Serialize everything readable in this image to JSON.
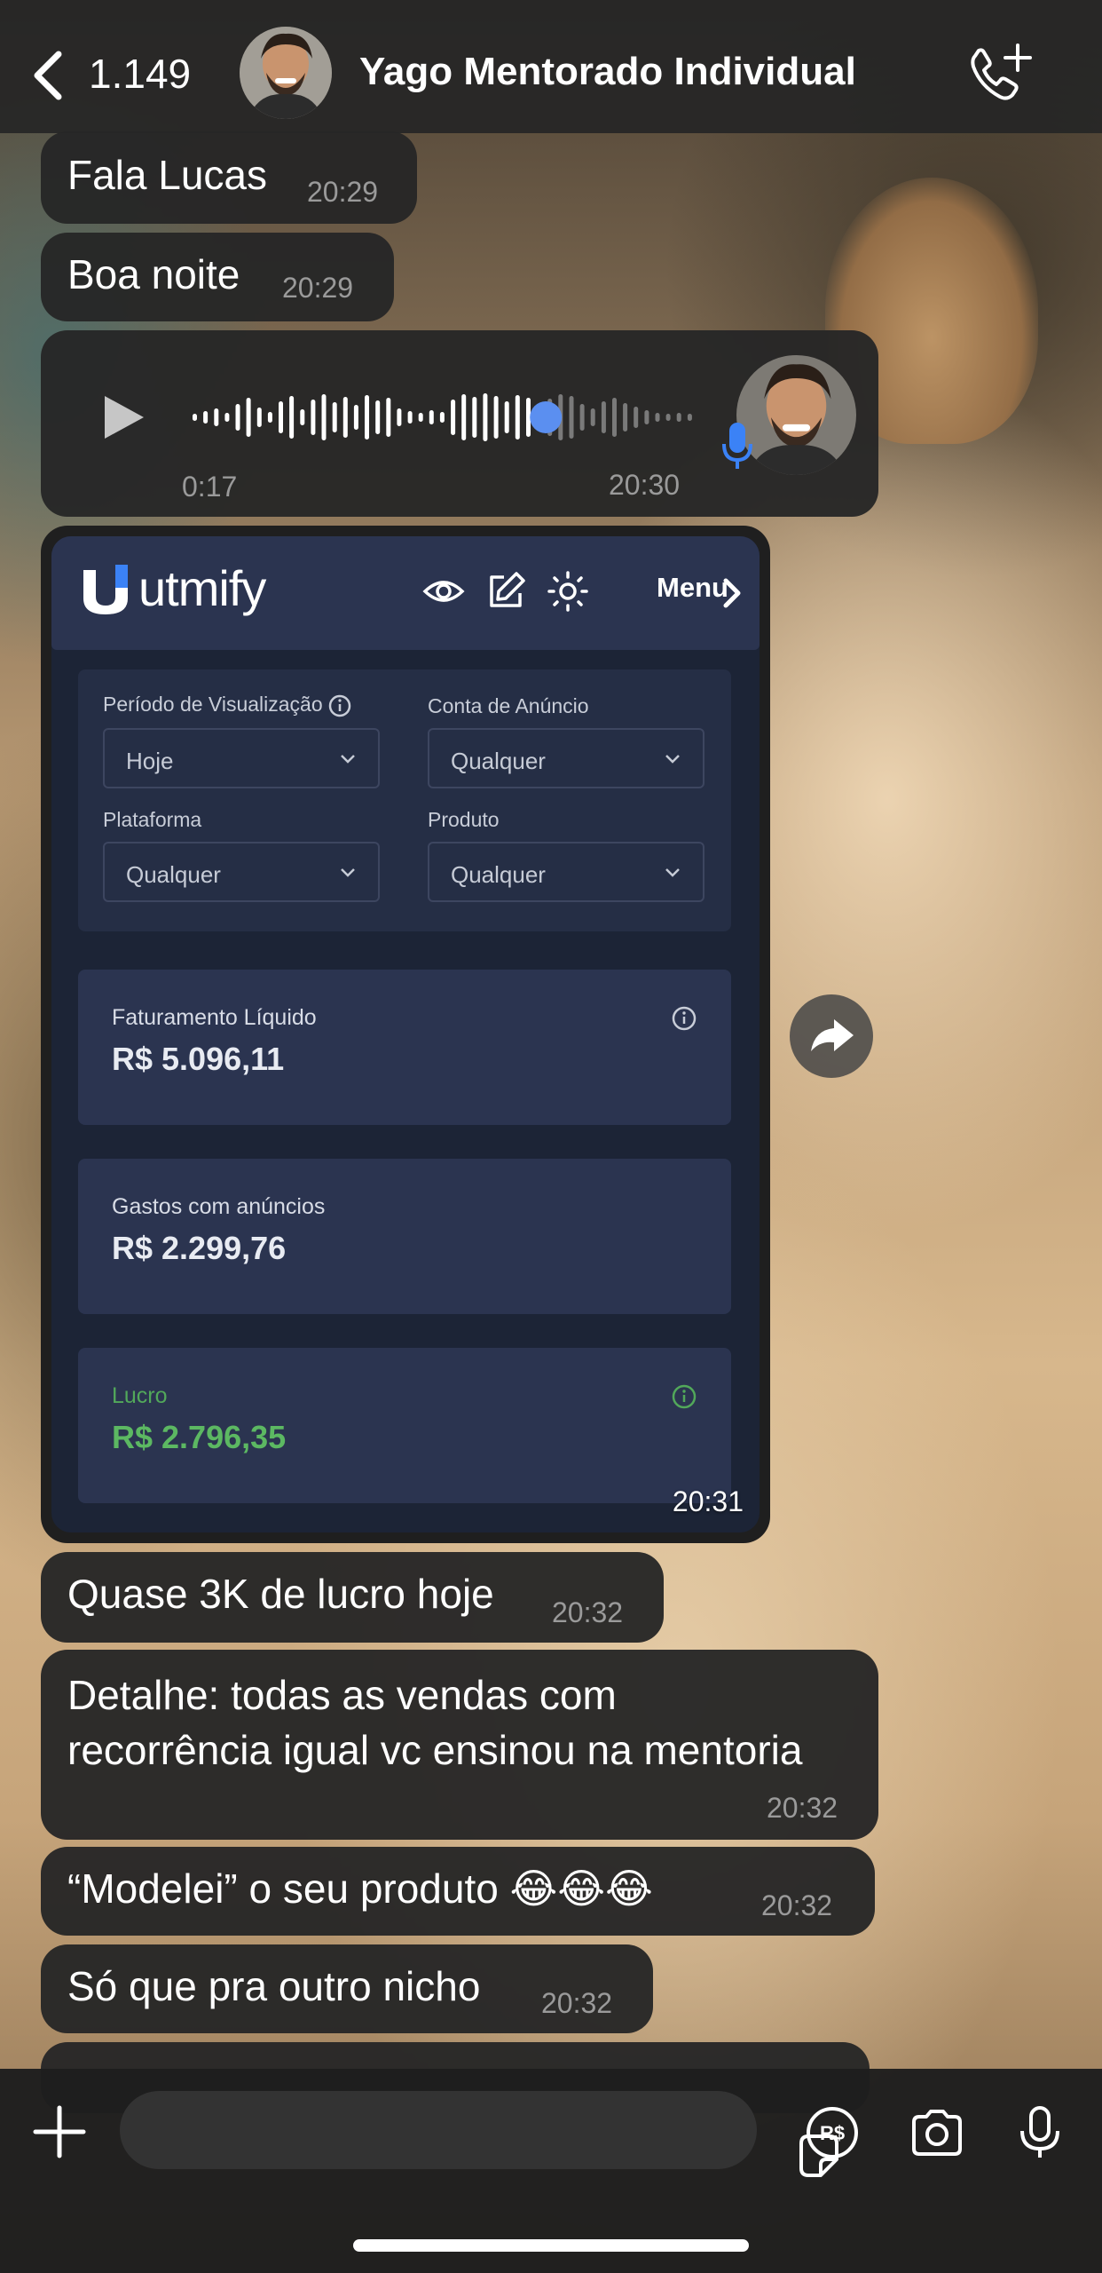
{
  "header": {
    "back_count": "1.149",
    "title": "Yago Mentorado Individual"
  },
  "messages": {
    "m1": {
      "text": "Fala Lucas",
      "time": "20:29"
    },
    "m2": {
      "text": "Boa noite",
      "time": "20:29"
    },
    "audio": {
      "duration": "0:17",
      "time": "20:30",
      "progress": 0.7
    },
    "m4_image_time": "20:31",
    "m5": {
      "text": "Quase 3K de lucro hoje",
      "time": "20:32"
    },
    "m6": {
      "line1": "Detalhe: todas as vendas com",
      "line2": "recorrência igual vc ensinou na mentoria",
      "time": "20:32"
    },
    "m7": {
      "text": "“Modelei” o seu produto 😂😂😂",
      "time": "20:32"
    },
    "m8": {
      "text": "Só que pra outro nicho",
      "time": "20:32"
    }
  },
  "screenshot": {
    "logo_text": "utmify",
    "menu_label": "Menu",
    "filters": {
      "period_label": "Período de Visualização",
      "period_value": "Hoje",
      "account_label": "Conta de Anúncio",
      "account_value": "Qualquer",
      "platform_label": "Plataforma",
      "platform_value": "Qualquer",
      "product_label": "Produto",
      "product_value": "Qualquer"
    },
    "metrics": {
      "revenue_label": "Faturamento Líquido",
      "revenue_value": "R$ 5.096,11",
      "ads_label": "Gastos com anúncios",
      "ads_value": "R$ 2.299,76",
      "profit_label": "Lucro",
      "profit_value": "R$ 2.796,35"
    },
    "colors": {
      "card": "#2b3450",
      "profit_green": "#5cb862",
      "background": "#1c2436"
    }
  },
  "colors": {
    "bubble": "#262626",
    "time_text": "#9a9a9a",
    "waveform_progress": "#5b8ff0"
  },
  "icons": [
    "back-chevron-icon",
    "call-add-icon",
    "play-icon",
    "mic-icon",
    "forward-icon",
    "plus-icon",
    "sticker-icon",
    "pix-icon",
    "camera-icon",
    "microphone-icon",
    "eye-icon",
    "edit-icon",
    "sun-icon",
    "info-icon",
    "chevron-down-icon"
  ]
}
